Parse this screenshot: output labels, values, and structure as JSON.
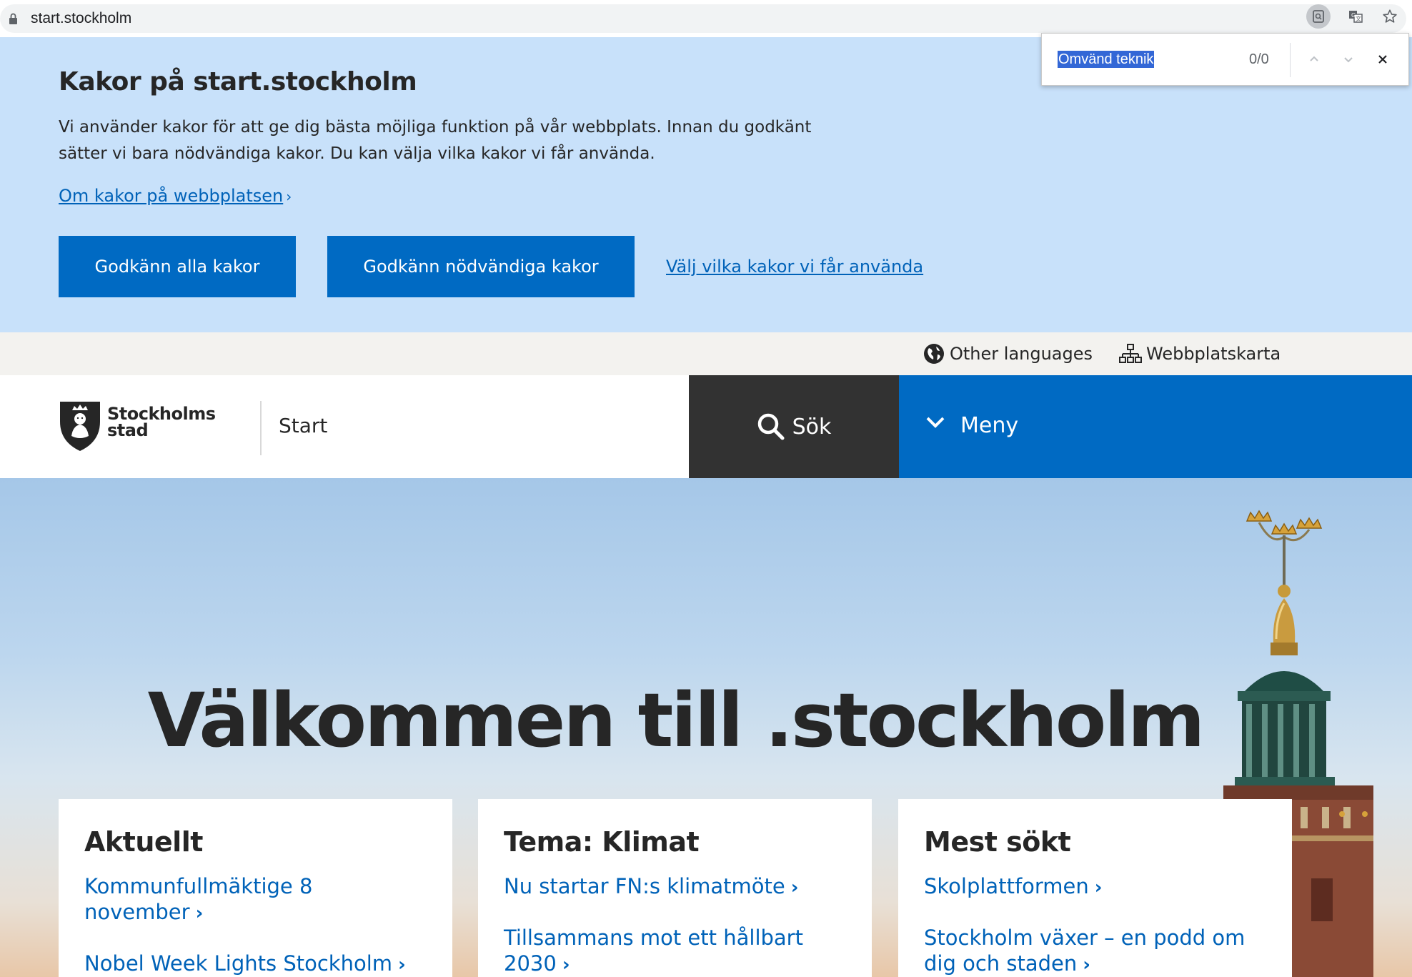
{
  "browser": {
    "url": "start.stockholm"
  },
  "findbar": {
    "query": "Omvänd teknik",
    "count": "0/0"
  },
  "cookie": {
    "title": "Kakor på start.stockholm",
    "description": "Vi använder kakor för att ge dig bästa möjliga funktion på vår webbplats. Innan du godkänt sätter vi bara nödvändiga kakor. Du kan välja vilka kakor vi får använda.",
    "about_link": "Om kakor på webbplatsen",
    "accept_all": "Godkänn alla kakor",
    "accept_necessary": "Godkänn nödvändiga kakor",
    "choose_link": "Välj vilka kakor vi får använda"
  },
  "utility": {
    "languages": "Other languages",
    "sitemap": "Webbplatskarta"
  },
  "header": {
    "logo_line1": "Stockholms",
    "logo_line2": "stad",
    "site_name": "Start",
    "search": "Sök",
    "menu": "Meny"
  },
  "hero": {
    "title": "Välkommen till .stockholm"
  },
  "cards": [
    {
      "title": "Aktuellt",
      "links": [
        "Kommunfullmäktige 8 november",
        "Nobel Week Lights Stockholm"
      ]
    },
    {
      "title": "Tema: Klimat",
      "links": [
        "Nu startar FN:s klimatmöte",
        "Tillsammans mot ett hållbart 2030"
      ]
    },
    {
      "title": "Mest sökt",
      "links": [
        "Skolplattformen",
        "Stockholm växer – en podd om dig och staden"
      ]
    }
  ],
  "colors": {
    "cookie_bg": "#c8e1fa",
    "primary_blue": "#006ac3",
    "link_blue": "#0062b8",
    "search_dark": "#323232",
    "utility_bg": "#f3f2ef"
  }
}
